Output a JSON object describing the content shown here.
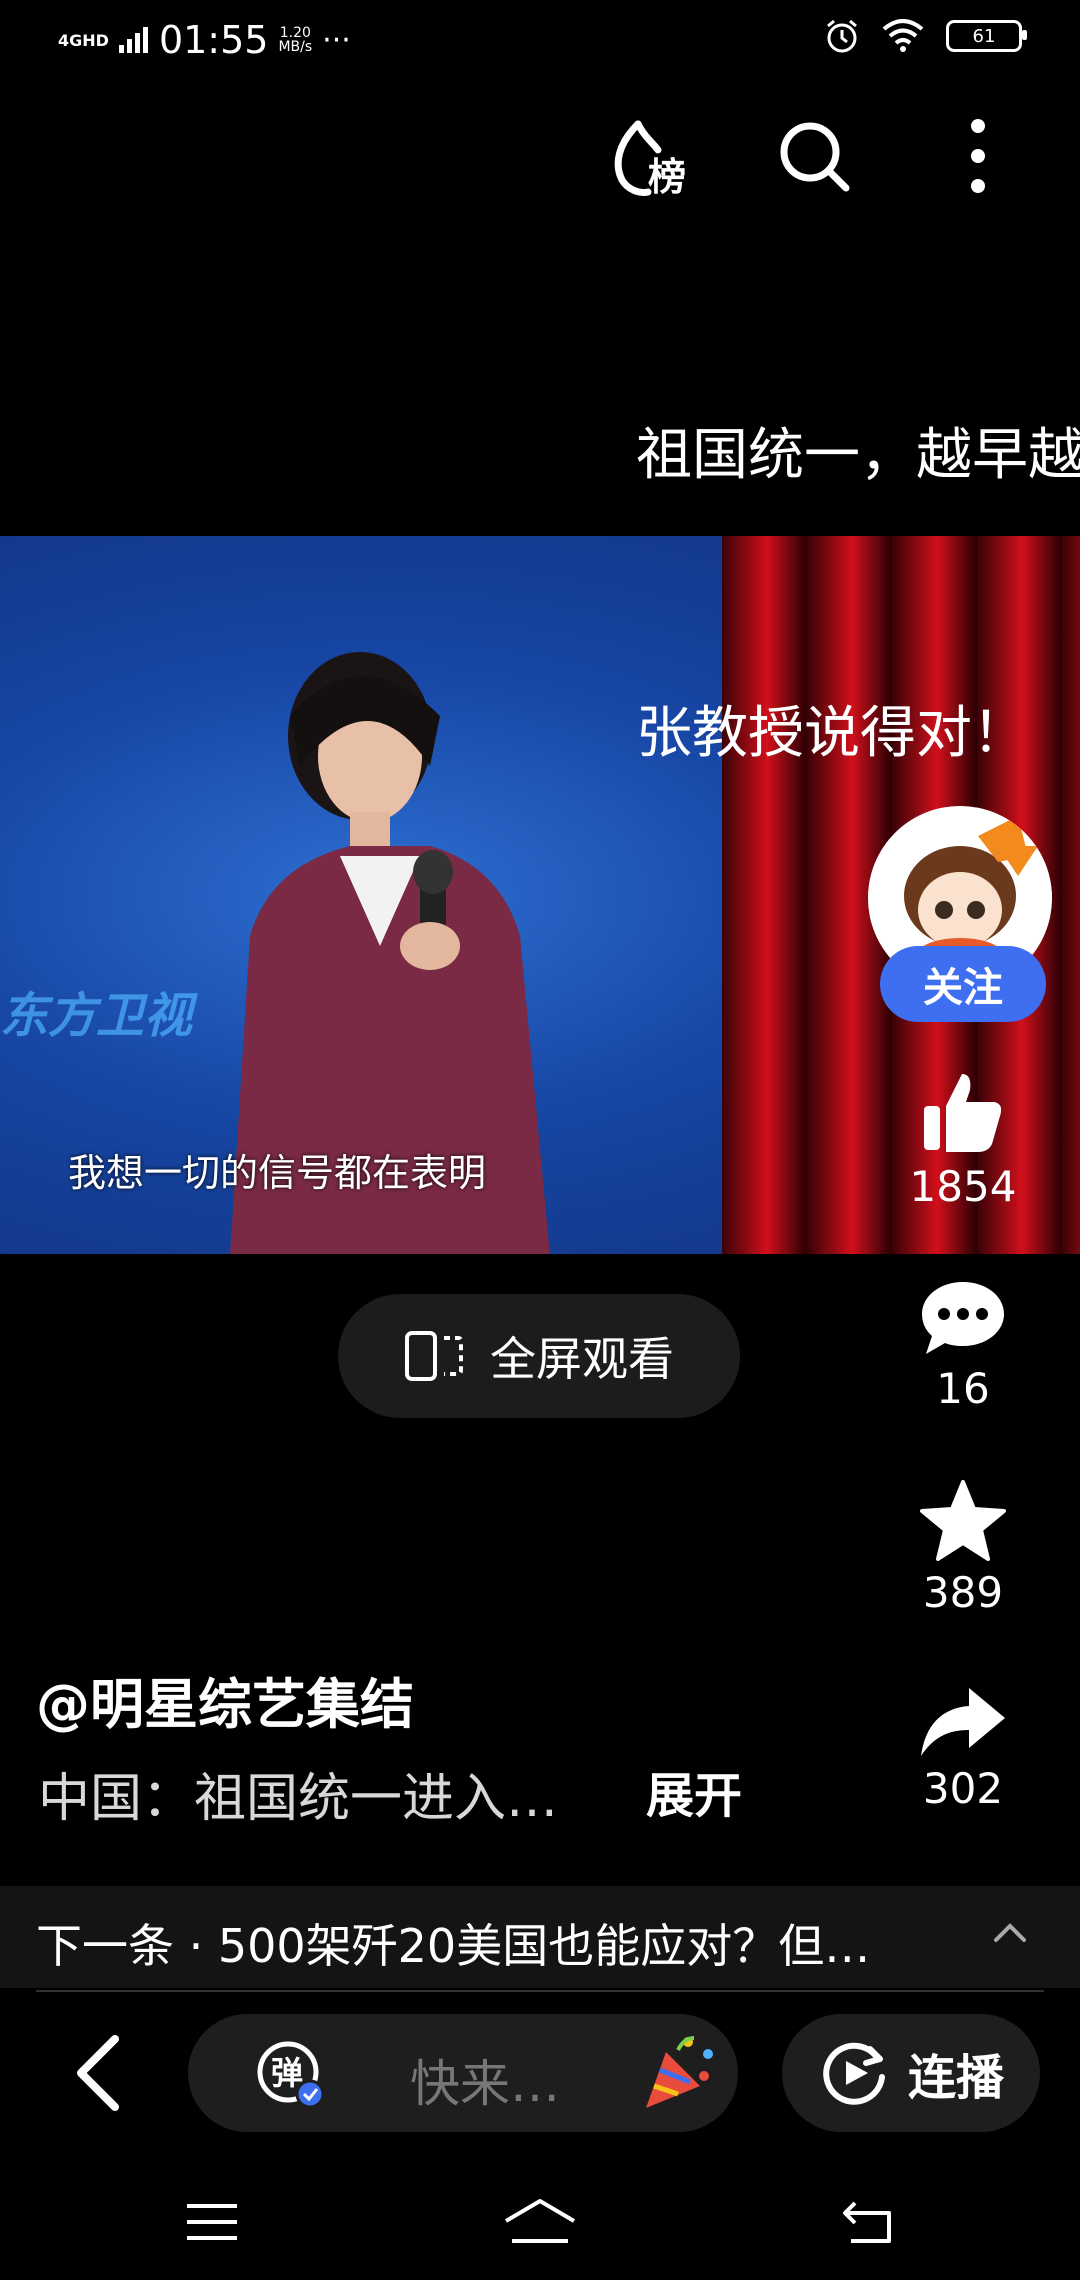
{
  "status_bar": {
    "network": "4GHD",
    "time": "01:55",
    "speed_value": "1.20",
    "speed_unit": "MB/s",
    "more": "···",
    "battery": "61"
  },
  "top_bar": {
    "ranking_icon_label": "榜"
  },
  "danmaku": [
    "祖国统一，越早越",
    "张教授说得对！"
  ],
  "video": {
    "subtitle": "我想一切的信号都在表明",
    "channel_logo": "东方卫视"
  },
  "author_panel": {
    "follow_label": "关注",
    "likes": "1854",
    "comments": "16",
    "favorites": "389",
    "shares": "302"
  },
  "fullscreen_label": "全屏观看",
  "post": {
    "author": "@明星综艺集结",
    "description": "中国：祖国统一进入…",
    "expand_label": "展开"
  },
  "next_bar": {
    "text": "下一条 · 500架歼20美国也能应对？但…"
  },
  "bottom_toolbar": {
    "danmu_label": "弹",
    "comment_placeholder": "快来…",
    "autoplay_label": "连播"
  },
  "colors": {
    "accent": "#3d6ff0",
    "background": "#000000"
  }
}
